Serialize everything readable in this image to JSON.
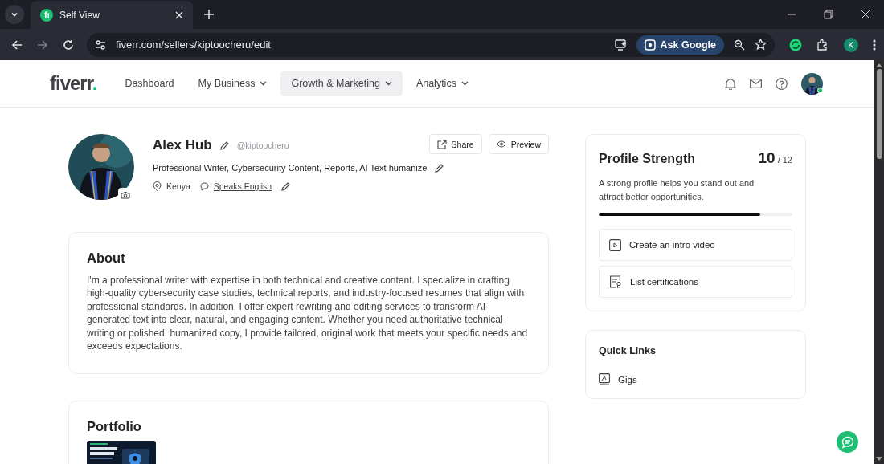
{
  "browser": {
    "tab_title": "Self View",
    "url": "fiverr.com/sellers/kiptoocheru/edit",
    "ask_google": "Ask Google",
    "profile_initial": "K"
  },
  "nav": {
    "logo": "fiverr",
    "logo_dot": ".",
    "items": [
      {
        "label": "Dashboard",
        "dropdown": false,
        "selected": false
      },
      {
        "label": "My Business",
        "dropdown": true,
        "selected": false
      },
      {
        "label": "Growth & Marketing",
        "dropdown": true,
        "selected": true
      },
      {
        "label": "Analytics",
        "dropdown": true,
        "selected": false
      }
    ],
    "online": true
  },
  "profile": {
    "name": "Alex Hub",
    "username": "@kiptoocheru",
    "tagline": "Professional Writer, Cybersecurity Content, Reports, AI Text humanize",
    "country": "Kenya",
    "language": "Speaks English",
    "actions": [
      {
        "label": "Share",
        "kind": "share"
      },
      {
        "label": "Preview",
        "kind": "preview"
      }
    ]
  },
  "strength": {
    "title": "Profile Strength",
    "score": "10",
    "total": "/ 12",
    "description": "A strong profile helps you stand out and attract better opportunities.",
    "level": 0.833,
    "tasks": [
      {
        "label": "Create an intro video",
        "kind": "video"
      },
      {
        "label": "List certifications",
        "kind": "certification"
      }
    ]
  },
  "about": {
    "title": "About",
    "text": "I'm a professional writer with expertise in both technical and creative content. I specialize in crafting high-quality cybersecurity case studies, technical reports, and industry-focused resumes that align with professional standards. In addition, I offer expert rewriting and editing services to transform AI-generated text into clear, natural, and engaging content. Whether you need authoritative technical writing or polished, humanized copy, I provide tailored, original work that meets your specific needs and exceeds expectations."
  },
  "quick_links": {
    "title": "Quick Links",
    "items": [
      {
        "label": "Gigs"
      }
    ]
  },
  "portfolio": {
    "title": "Portfolio"
  }
}
